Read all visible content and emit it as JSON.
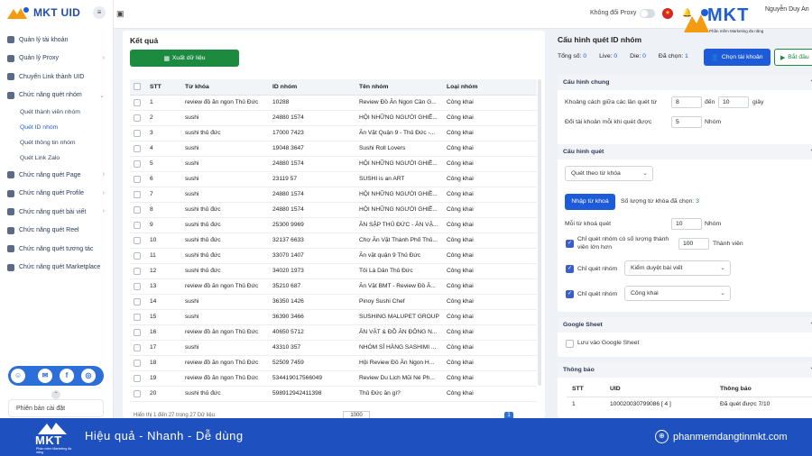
{
  "sidebar": {
    "logo": "MKT UID",
    "items": [
      {
        "label": "Quản lý tài khoản"
      },
      {
        "label": "Quản lý Proxy"
      },
      {
        "label": "Chuyển Link thành UID"
      },
      {
        "label": "Chức năng quét nhóm"
      }
    ],
    "subitems": [
      {
        "label": "Quét thành viên nhóm"
      },
      {
        "label": "Quét ID nhóm"
      },
      {
        "label": "Quét thông tin nhóm"
      },
      {
        "label": "Quét Link Zalo"
      }
    ],
    "items2": [
      {
        "label": "Chức năng quét Page"
      },
      {
        "label": "Chức năng quét Profile"
      },
      {
        "label": "Chức năng quét bài viết"
      },
      {
        "label": "Chức năng quét Reel"
      },
      {
        "label": "Chức năng quét tương tác"
      },
      {
        "label": "Chức năng quét Marketplace"
      }
    ],
    "version": "Phiên bản cài đặt"
  },
  "topbar": {
    "proxy_label": "Không đổi Proxy",
    "user_name": "Nguyễn Duy An",
    "brand_name": "MKT",
    "brand_sub": "Phần mềm Marketing đa năng"
  },
  "main": {
    "title": "Kết quả",
    "export_label": "Xuất dữ liệu",
    "columns": [
      "STT",
      "Từ khóa",
      "ID nhóm",
      "Tên nhóm",
      "Loại nhóm"
    ],
    "rows": [
      [
        "1",
        "review đồ ăn ngon Thủ Đức",
        "10288",
        "Review Đồ Ăn Ngon Cần G...",
        "Công khai"
      ],
      [
        "2",
        "sushi",
        "24880 1574",
        "HỘI NHỮNG NGƯỜI GHIỀ...",
        "Công khai"
      ],
      [
        "3",
        "sushi thủ đức",
        "17000 7423",
        "Ăn Vặt Quận 9 - Thủ Đức -...",
        "Công khai"
      ],
      [
        "4",
        "sushi",
        "19048 3647",
        "Sushi Roll Lovers",
        "Công khai"
      ],
      [
        "5",
        "sushi",
        "24880 1574",
        "HỘI NHỮNG NGƯỜI GHIỀ...",
        "Công khai"
      ],
      [
        "6",
        "sushi",
        "23119 57",
        "SUSHI is an ART",
        "Công khai"
      ],
      [
        "7",
        "sushi",
        "24880 1574",
        "HỘI NHỮNG NGƯỜI GHIỀ...",
        "Công khai"
      ],
      [
        "8",
        "sushi thủ đức",
        "24880 1574",
        "HỘI NHỮNG NGƯỜI GHIỀ...",
        "Công khai"
      ],
      [
        "9",
        "sushi thủ đức",
        "25300 9969",
        "ĂN SẬP THỦ ĐỨC - ĂN VẶ...",
        "Công khai"
      ],
      [
        "10",
        "sushi thủ đức",
        "32137 6633",
        "Chợ Ăn Vặt Thành Phố Thủ...",
        "Công khai"
      ],
      [
        "11",
        "sushi thủ đức",
        "33070 1407",
        "Ăn vặt quận 9 Thủ Đức",
        "Công khai"
      ],
      [
        "12",
        "sushi thủ đức",
        "34020 1973",
        "Tôi Là Dân Thủ Đức",
        "Công khai"
      ],
      [
        "13",
        "review đồ ăn ngon Thủ Đức",
        "35210 687",
        "Ăn Vặt BMT - Review Đồ Ă...",
        "Công khai"
      ],
      [
        "14",
        "sushi",
        "36350 1426",
        "Pinoy Sushi Chef",
        "Công khai"
      ],
      [
        "15",
        "sushi",
        "36390 3466",
        "SUSHING MALUPET GROUP",
        "Công khai"
      ],
      [
        "16",
        "review đồ ăn ngon Thủ Đức",
        "40650 5712",
        "ĂN VẶT & ĐỒ ĂN ĐÔNG N...",
        "Công khai"
      ],
      [
        "17",
        "sushi",
        "43310 357",
        "NHÓM SỈ HÀNG SASHIMI ...",
        "Công khai"
      ],
      [
        "18",
        "review đồ ăn ngon Thủ Đức",
        "52509 7459",
        "Hội Review Đồ Ăn Ngon H...",
        "Công khai"
      ],
      [
        "19",
        "review đồ ăn ngon Thủ Đức",
        "534419017566049",
        "Review Du Lịch Mũi Né Ph...",
        "Công khai"
      ],
      [
        "20",
        "sushi thủ đức",
        "598912942411398",
        "Thủ Đức ăn gì?",
        "Công khai"
      ]
    ],
    "footer": "Hiển thị 1 đến 27 trong 27 Dữ liệu",
    "page_size": "1000",
    "page": "1"
  },
  "config": {
    "title": "Cấu hình quét ID nhóm",
    "stats": {
      "total_label": "Tổng số:",
      "total": "0",
      "live_label": "Live:",
      "live": "0",
      "die_label": "Die:",
      "die": "0",
      "selected_label": "Đã chọn:",
      "selected": "1"
    },
    "choose_account": "Chọn tài khoản",
    "start": "Bắt đầu",
    "general": {
      "title": "Cấu hình chung",
      "delay_label": "Khoảng cách giữa các lần quét từ",
      "delay_from": "8",
      "delay_to_label": "đến",
      "delay_to": "10",
      "delay_unit": "giây",
      "switch_label": "Đổi tài khoản mỗi khi quét được",
      "switch_value": "5",
      "switch_unit": "Nhóm"
    },
    "scan": {
      "title": "Cấu hình quét",
      "mode": "Quét theo từ khóa",
      "import_label": "Nhập từ khoá",
      "keyword_count_label": "Số lượng từ khóa đã chọn:",
      "keyword_count": "3",
      "per_keyword_label": "Mỗi từ khoá quét",
      "per_keyword_value": "10",
      "per_keyword_unit": "Nhóm",
      "members_label": "Chỉ quét nhóm có số lượng thành viên lớn hơn",
      "members_value": "100",
      "members_unit": "Thành viên",
      "group_filter1_label": "Chỉ quét nhóm",
      "group_filter1_value": "Kiểm duyệt bài viết",
      "group_filter2_label": "Chỉ quét nhóm",
      "group_filter2_value": "Công khai"
    },
    "sheet": {
      "title": "Google Sheet",
      "save_label": "Lưu vào Google Sheet"
    },
    "notice": {
      "title": "Thông báo",
      "columns": [
        "STT",
        "UID",
        "Thông báo"
      ],
      "rows": [
        [
          "1",
          "100020030799086 [ 4 ]",
          "Đã quét được 7/10"
        ]
      ]
    }
  },
  "banner": {
    "logo": "MKT",
    "logo_sub": "Phần mềm Marketing đa năng",
    "slogan": "Hiệu quả - Nhanh - Dễ dùng",
    "site": "phanmemdangtinmkt.com"
  },
  "colors": {
    "primary": "#1e5bd8",
    "success": "#1c8a3f",
    "banner": "#1e50c0"
  }
}
